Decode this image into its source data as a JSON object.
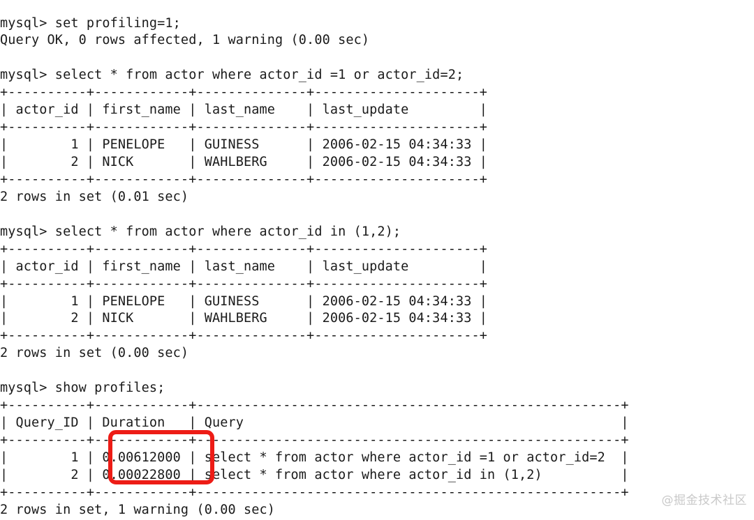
{
  "terminal": {
    "prompt": "mysql>",
    "lines": [
      "mysql> set profiling=1;",
      "Query OK, 0 rows affected, 1 warning (0.00 sec)",
      "",
      "mysql> select * from actor where actor_id =1 or actor_id=2;",
      "+----------+------------+--------------+---------------------+",
      "| actor_id | first_name | last_name    | last_update         |",
      "+----------+------------+--------------+---------------------+",
      "|        1 | PENELOPE   | GUINESS      | 2006-02-15 04:34:33 |",
      "|        2 | NICK       | WAHLBERG     | 2006-02-15 04:34:33 |",
      "+----------+------------+--------------+---------------------+",
      "2 rows in set (0.01 sec)",
      "",
      "mysql> select * from actor where actor_id in (1,2);",
      "+----------+------------+--------------+---------------------+",
      "| actor_id | first_name | last_name    | last_update         |",
      "+----------+------------+--------------+---------------------+",
      "|        1 | PENELOPE   | GUINESS      | 2006-02-15 04:34:33 |",
      "|        2 | NICK       | WAHLBERG     | 2006-02-15 04:34:33 |",
      "+----------+------------+--------------+---------------------+",
      "2 rows in set (0.00 sec)",
      "",
      "mysql> show profiles;",
      "+----------+------------+------------------------------------------------------+",
      "| Query_ID | Duration   | Query                                                |",
      "+----------+------------+------------------------------------------------------+",
      "|        1 | 0.00612000 | select * from actor where actor_id =1 or actor_id=2  |",
      "|        2 | 0.00022800 | select * from actor where actor_id in (1,2)          |",
      "+----------+------------+------------------------------------------------------+",
      "2 rows in set, 1 warning (0.00 sec)"
    ],
    "commands": [
      "set profiling=1;",
      "select * from actor where actor_id =1 or actor_id=2;",
      "select * from actor where actor_id in (1,2);",
      "show profiles;"
    ],
    "status_messages": [
      "Query OK, 0 rows affected, 1 warning (0.00 sec)",
      "2 rows in set (0.01 sec)",
      "2 rows in set (0.00 sec)",
      "2 rows in set, 1 warning (0.00 sec)"
    ],
    "actor_table": {
      "columns": [
        "actor_id",
        "first_name",
        "last_name",
        "last_update"
      ],
      "rows": [
        [
          "1",
          "PENELOPE",
          "GUINESS",
          "2006-02-15 04:34:33"
        ],
        [
          "2",
          "NICK",
          "WAHLBERG",
          "2006-02-15 04:34:33"
        ]
      ]
    },
    "profiles_table": {
      "columns": [
        "Query_ID",
        "Duration",
        "Query"
      ],
      "rows": [
        [
          "1",
          "0.00612000",
          "select * from actor where actor_id =1 or actor_id=2"
        ],
        [
          "2",
          "0.00022800",
          "select * from actor where actor_id in (1,2)"
        ]
      ]
    }
  },
  "annotation": {
    "highlight_color": "#ed1c16",
    "highlight_target": "Duration column values"
  },
  "watermark": {
    "text": "@掘金技术社区",
    "color": "#c9c9c9"
  }
}
